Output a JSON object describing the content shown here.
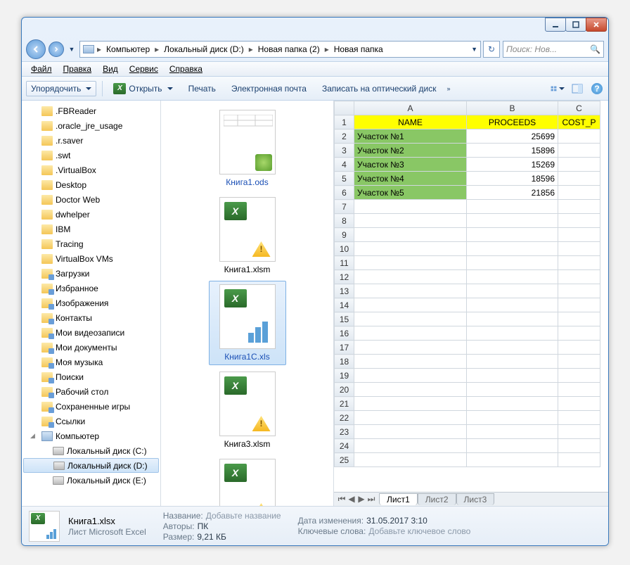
{
  "breadcrumb": [
    "Компьютер",
    "Локальный диск (D:)",
    "Новая папка (2)",
    "Новая папка"
  ],
  "search_placeholder": "Поиск: Нов...",
  "menu": [
    "Файл",
    "Правка",
    "Вид",
    "Сервис",
    "Справка"
  ],
  "toolbar": {
    "organize": "Упорядочить",
    "open": "Открыть",
    "print": "Печать",
    "email": "Электронная почта",
    "burn": "Записать на оптический диск"
  },
  "tree": [
    {
      "l": 1,
      "t": "f",
      "n": ".FBReader"
    },
    {
      "l": 1,
      "t": "f",
      "n": ".oracle_jre_usage"
    },
    {
      "l": 1,
      "t": "f",
      "n": ".r.saver"
    },
    {
      "l": 1,
      "t": "f",
      "n": ".swt"
    },
    {
      "l": 1,
      "t": "f",
      "n": ".VirtualBox"
    },
    {
      "l": 1,
      "t": "f",
      "n": "Desktop"
    },
    {
      "l": 1,
      "t": "f",
      "n": "Doctor Web"
    },
    {
      "l": 1,
      "t": "f",
      "n": "dwhelper"
    },
    {
      "l": 1,
      "t": "f",
      "n": "IBM"
    },
    {
      "l": 1,
      "t": "f",
      "n": "Tracing"
    },
    {
      "l": 1,
      "t": "f",
      "n": "VirtualBox VMs"
    },
    {
      "l": 1,
      "t": "fs",
      "n": "Загрузки"
    },
    {
      "l": 1,
      "t": "fs",
      "n": "Избранное"
    },
    {
      "l": 1,
      "t": "fs",
      "n": "Изображения"
    },
    {
      "l": 1,
      "t": "fs",
      "n": "Контакты"
    },
    {
      "l": 1,
      "t": "fs",
      "n": "Мои видеозаписи"
    },
    {
      "l": 1,
      "t": "fs",
      "n": "Мои документы"
    },
    {
      "l": 1,
      "t": "fs",
      "n": "Моя музыка"
    },
    {
      "l": 1,
      "t": "fs",
      "n": "Поиски"
    },
    {
      "l": 1,
      "t": "fs",
      "n": "Рабочий стол"
    },
    {
      "l": 1,
      "t": "fs",
      "n": "Сохраненные игры"
    },
    {
      "l": 1,
      "t": "fs",
      "n": "Ссылки"
    },
    {
      "l": 1,
      "t": "p",
      "n": "Компьютер",
      "exp": true
    },
    {
      "l": 2,
      "t": "d",
      "n": "Локальный диск (C:)"
    },
    {
      "l": 2,
      "t": "d",
      "n": "Локальный диск (D:)",
      "sel": true
    },
    {
      "l": 2,
      "t": "d",
      "n": "Локальный диск (E:)"
    }
  ],
  "files": [
    {
      "name": "Книга1.ods",
      "kind": "ods",
      "link": true
    },
    {
      "name": "Книга1.xlsm",
      "kind": "xlsm"
    },
    {
      "name": "Книга1C.xls",
      "kind": "xls",
      "sel": true,
      "link": true
    },
    {
      "name": "Книга3.xlsm",
      "kind": "xlsm"
    },
    {
      "name": "",
      "kind": "xlsm"
    }
  ],
  "chart_data": {
    "type": "table",
    "columns": [
      "A",
      "B",
      "C"
    ],
    "headers": [
      "NAME",
      "PROCEEDS",
      "COST_P"
    ],
    "rows": [
      [
        "Участок №1",
        25699,
        ""
      ],
      [
        "Участок №2",
        15896,
        ""
      ],
      [
        "Участок №3",
        15269,
        ""
      ],
      [
        "Участок №4",
        18596,
        ""
      ],
      [
        "Участок №5",
        21856,
        ""
      ]
    ]
  },
  "sheets": [
    "Лист1",
    "Лист2",
    "Лист3"
  ],
  "details": {
    "filename": "Книга1.xlsx",
    "filetype": "Лист Microsoft Excel",
    "labels": {
      "title": "Название:",
      "authors": "Авторы:",
      "size": "Размер:",
      "modified": "Дата изменения:",
      "keywords": "Ключевые слова:"
    },
    "values": {
      "title_ph": "Добавьте название",
      "authors": "ПК",
      "size": "9,21 КБ",
      "modified": "31.05.2017 3:10",
      "keywords_ph": "Добавьте ключевое слово"
    }
  }
}
